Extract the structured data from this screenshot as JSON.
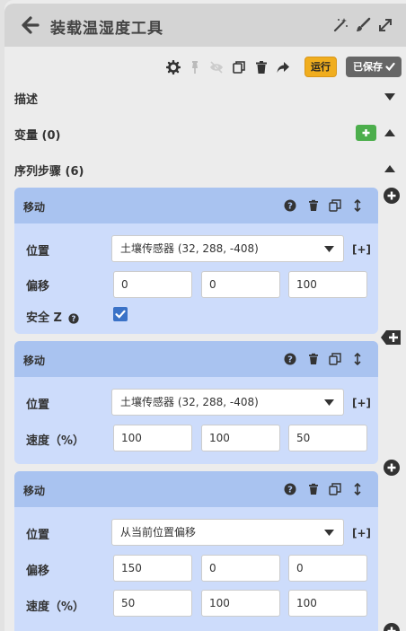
{
  "window": {
    "title": "装载温湿度工具"
  },
  "toolbar": {
    "run_label": "运行",
    "saved_label": "已保存"
  },
  "sections": {
    "description": "描述",
    "variables": "变量 (0)",
    "sequence": "序列步骤 (6)"
  },
  "steps": [
    {
      "title": "移动",
      "position_label": "位置",
      "position_value": "土壤传感器 (32, 288, -408)",
      "bracket": "[+]",
      "offset_label": "偏移",
      "offset": [
        "0",
        "0",
        "100"
      ],
      "safe_z_label": "安全 Z",
      "safe_z_checked": true
    },
    {
      "title": "移动",
      "position_label": "位置",
      "position_value": "土壤传感器 (32, 288, -408)",
      "bracket": "[+]",
      "speed_label": "速度（%）",
      "speed": [
        "100",
        "100",
        "50"
      ]
    },
    {
      "title": "移动",
      "position_label": "位置",
      "position_value": "从当前位置偏移",
      "bracket": "[+]",
      "offset_label": "偏移",
      "offset": [
        "150",
        "0",
        "0"
      ],
      "speed_label": "速度（%）",
      "speed": [
        "50",
        "100",
        "100"
      ]
    }
  ],
  "colors": {
    "run_button": "#f0ad1e",
    "saved_button": "#666666",
    "card_header": "#a9c3f0",
    "card_body": "#cddcfb",
    "add_variable": "#4cae4c"
  }
}
